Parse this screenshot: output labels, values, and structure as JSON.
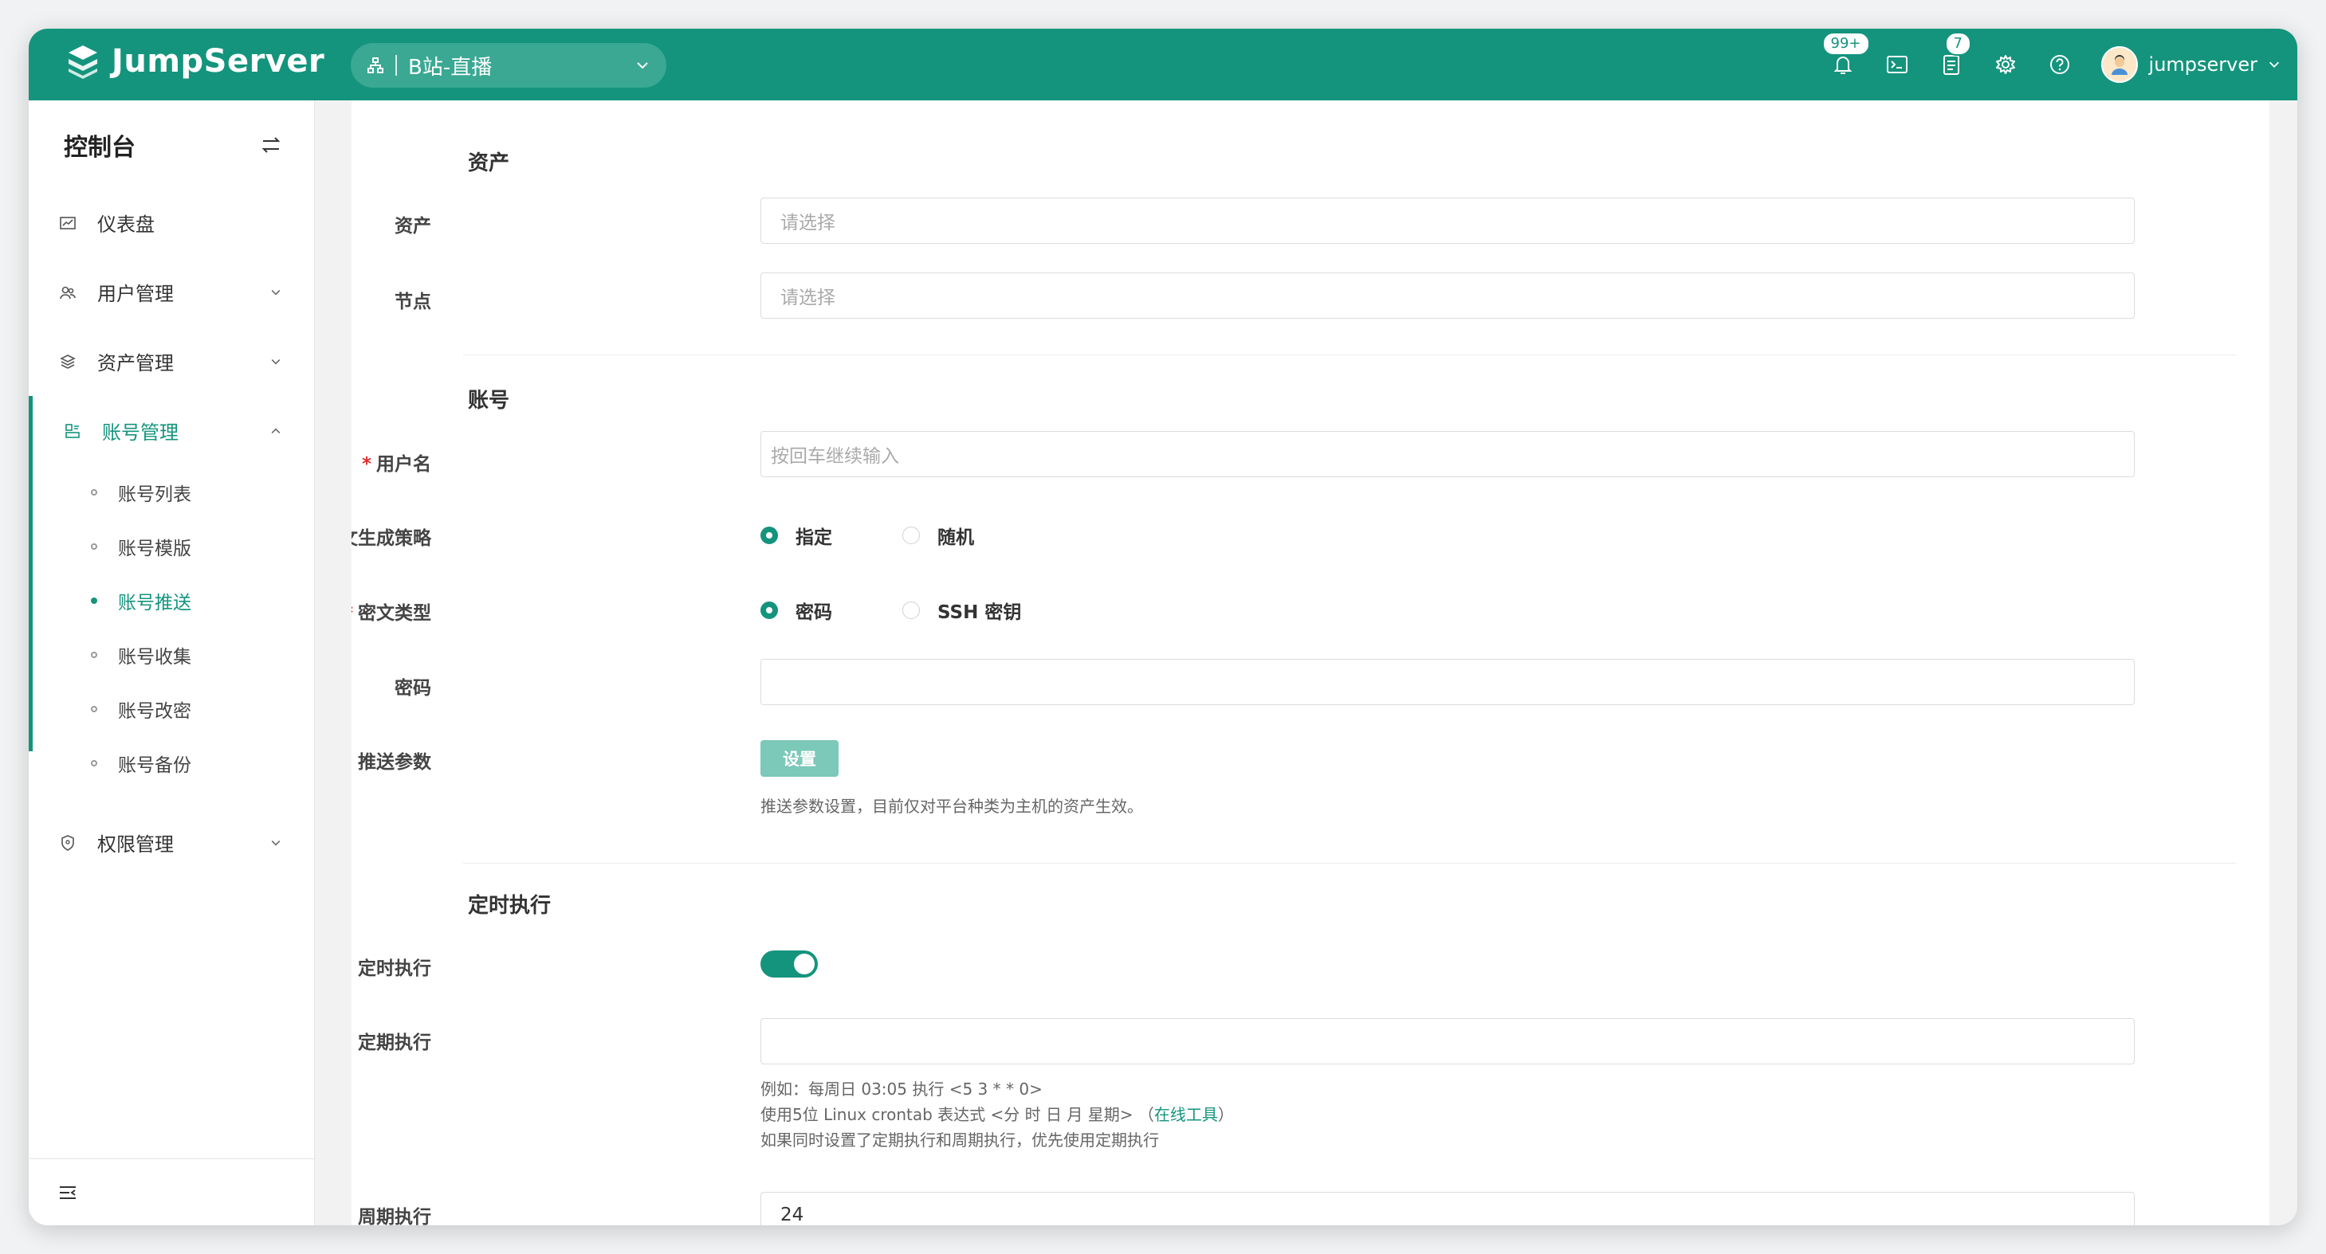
{
  "app": {
    "brand": "JumpServer",
    "accent": "#14947d"
  },
  "org": {
    "name": "B站-直播"
  },
  "topbar": {
    "notifications_badge": "99+",
    "tasks_badge": "7",
    "username": "jumpserver"
  },
  "sidebar": {
    "title": "控制台",
    "items": [
      {
        "label": "仪表盘",
        "icon": "dashboard-icon"
      },
      {
        "label": "用户管理",
        "icon": "users-icon"
      },
      {
        "label": "资产管理",
        "icon": "assets-icon"
      },
      {
        "label": "账号管理",
        "icon": "accounts-icon"
      },
      {
        "label": "权限管理",
        "icon": "permissions-icon"
      }
    ],
    "subitems": [
      {
        "label": "账号列表"
      },
      {
        "label": "账号模版"
      },
      {
        "label": "账号推送"
      },
      {
        "label": "账号收集"
      },
      {
        "label": "账号改密"
      },
      {
        "label": "账号备份"
      }
    ]
  },
  "form": {
    "sec_asset": "资产",
    "asset_label": "资产",
    "asset_placeholder": "请选择",
    "node_label": "节点",
    "node_placeholder": "请选择",
    "sec_account": "账号",
    "username_label": "用户名",
    "username_placeholder": "按回车继续输入",
    "secret_strategy_label": "密文生成策略",
    "strategy_specify": "指定",
    "strategy_random": "随机",
    "secret_type_label": "密文类型",
    "type_password": "密码",
    "type_ssh": "SSH 密钥",
    "password_label": "密码",
    "push_params_label": "推送参数",
    "push_params_button": "设置",
    "push_params_help": "推送参数设置，目前仅对平台种类为主机的资产生效。",
    "sec_schedule": "定时执行",
    "schedule_toggle_label": "定时执行",
    "crontab_label": "定期执行",
    "crontab_help_1": "例如：每周日 03:05 执行 <5 3 * * 0>",
    "crontab_help_2a": "使用5位 Linux crontab 表达式 <分 时 日 月 星期> （",
    "crontab_help_2_link": "在线工具",
    "crontab_help_2b": "）",
    "crontab_help_3": "如果同时设置了定期执行和周期执行，优先使用定期执行",
    "interval_label": "周期执行",
    "interval_value": "24"
  }
}
